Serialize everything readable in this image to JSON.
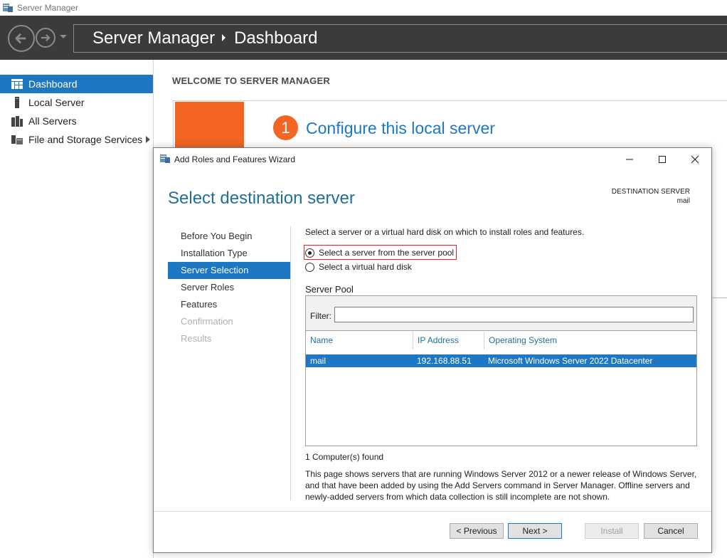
{
  "window": {
    "title": "Server Manager"
  },
  "header": {
    "breadcrumb_root": "Server Manager",
    "breadcrumb_current": "Dashboard"
  },
  "sidebar": {
    "items": [
      {
        "label": "Dashboard",
        "icon": "dashboard-icon",
        "active": true
      },
      {
        "label": "Local Server",
        "icon": "server-icon"
      },
      {
        "label": "All Servers",
        "icon": "servers-icon"
      },
      {
        "label": "File and Storage Services",
        "icon": "storage-icon",
        "has_submenu": true
      }
    ]
  },
  "dashboard": {
    "welcome": "WELCOME TO SERVER MANAGER",
    "step_number": "1",
    "configure_link": "Configure this local server",
    "accent_color": "#f26522"
  },
  "wizard": {
    "title": "Add Roles and Features Wizard",
    "heading": "Select destination server",
    "destination_label": "DESTINATION SERVER",
    "destination_value": "mail",
    "nav": [
      {
        "label": "Before You Begin",
        "state": "normal"
      },
      {
        "label": "Installation Type",
        "state": "normal"
      },
      {
        "label": "Server Selection",
        "state": "active"
      },
      {
        "label": "Server Roles",
        "state": "normal"
      },
      {
        "label": "Features",
        "state": "normal"
      },
      {
        "label": "Confirmation",
        "state": "disabled"
      },
      {
        "label": "Results",
        "state": "disabled"
      }
    ],
    "instruction": "Select a server or a virtual hard disk on which to install roles and features.",
    "options": {
      "pool": "Select a server from the server pool",
      "vhd": "Select a virtual hard disk",
      "selected": "pool"
    },
    "pool_label": "Server Pool",
    "filter_label": "Filter:",
    "filter_value": "",
    "columns": {
      "name": "Name",
      "ip": "IP Address",
      "os": "Operating System"
    },
    "rows": [
      {
        "name": "mail",
        "ip": "192.168.88.51",
        "os": "Microsoft Windows Server 2022 Datacenter",
        "selected": true
      }
    ],
    "found": "1 Computer(s) found",
    "note": "This page shows servers that are running Windows Server 2012 or a newer release of Windows Server, and that have been added by using the Add Servers command in Server Manager. Offline servers and newly-added servers from which data collection is still incomplete are not shown.",
    "buttons": {
      "previous": "< Previous",
      "next": "Next >",
      "install": "Install",
      "cancel": "Cancel"
    }
  },
  "colors": {
    "header_bg": "#3b3b3b",
    "selection_blue": "#1e77c2",
    "heading_blue": "#1e6e9e",
    "highlight_red": "#d7262a"
  }
}
